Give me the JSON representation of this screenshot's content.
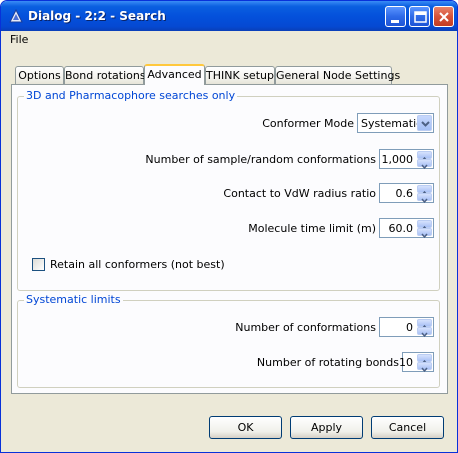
{
  "window": {
    "title": "Dialog - 2:2 - Search",
    "icon": "triangle-app-icon",
    "controls": {
      "minimize": "minimize-icon",
      "maximize": "maximize-icon",
      "close": "close-icon"
    }
  },
  "menu": {
    "file": "File"
  },
  "tabs": [
    {
      "label": "Options"
    },
    {
      "label": "Bond rotations"
    },
    {
      "label": "Advanced"
    },
    {
      "label": "THINK setup"
    },
    {
      "label": "General Node Settings"
    }
  ],
  "active_tab": "Advanced",
  "pharma_group": {
    "title": "3D and Pharmacophore searches only",
    "conformer_mode_label": "Conformer Mode",
    "conformer_mode_value": "Systematic",
    "num_sample_label": "Number of sample/random conformations",
    "num_sample_value": "1,000",
    "contact_label": "Contact to VdW radius ratio",
    "contact_value": "0.6",
    "time_limit_label": "Molecule time limit (m)",
    "time_limit_value": "60.0",
    "retain_label": "Retain all conformers (not best)",
    "retain_checked": false
  },
  "systematic_group": {
    "title": "Systematic limits",
    "num_conf_label": "Number of conformations",
    "num_conf_value": "0",
    "num_rot_label": "Number of rotating bonds",
    "num_rot_value": "10"
  },
  "buttons": {
    "ok": "OK",
    "apply": "Apply",
    "cancel": "Cancel"
  },
  "colors": {
    "title_bar": "#0451dc",
    "group_title": "#0046d5",
    "active_tab_accent": "#ffc83c"
  }
}
